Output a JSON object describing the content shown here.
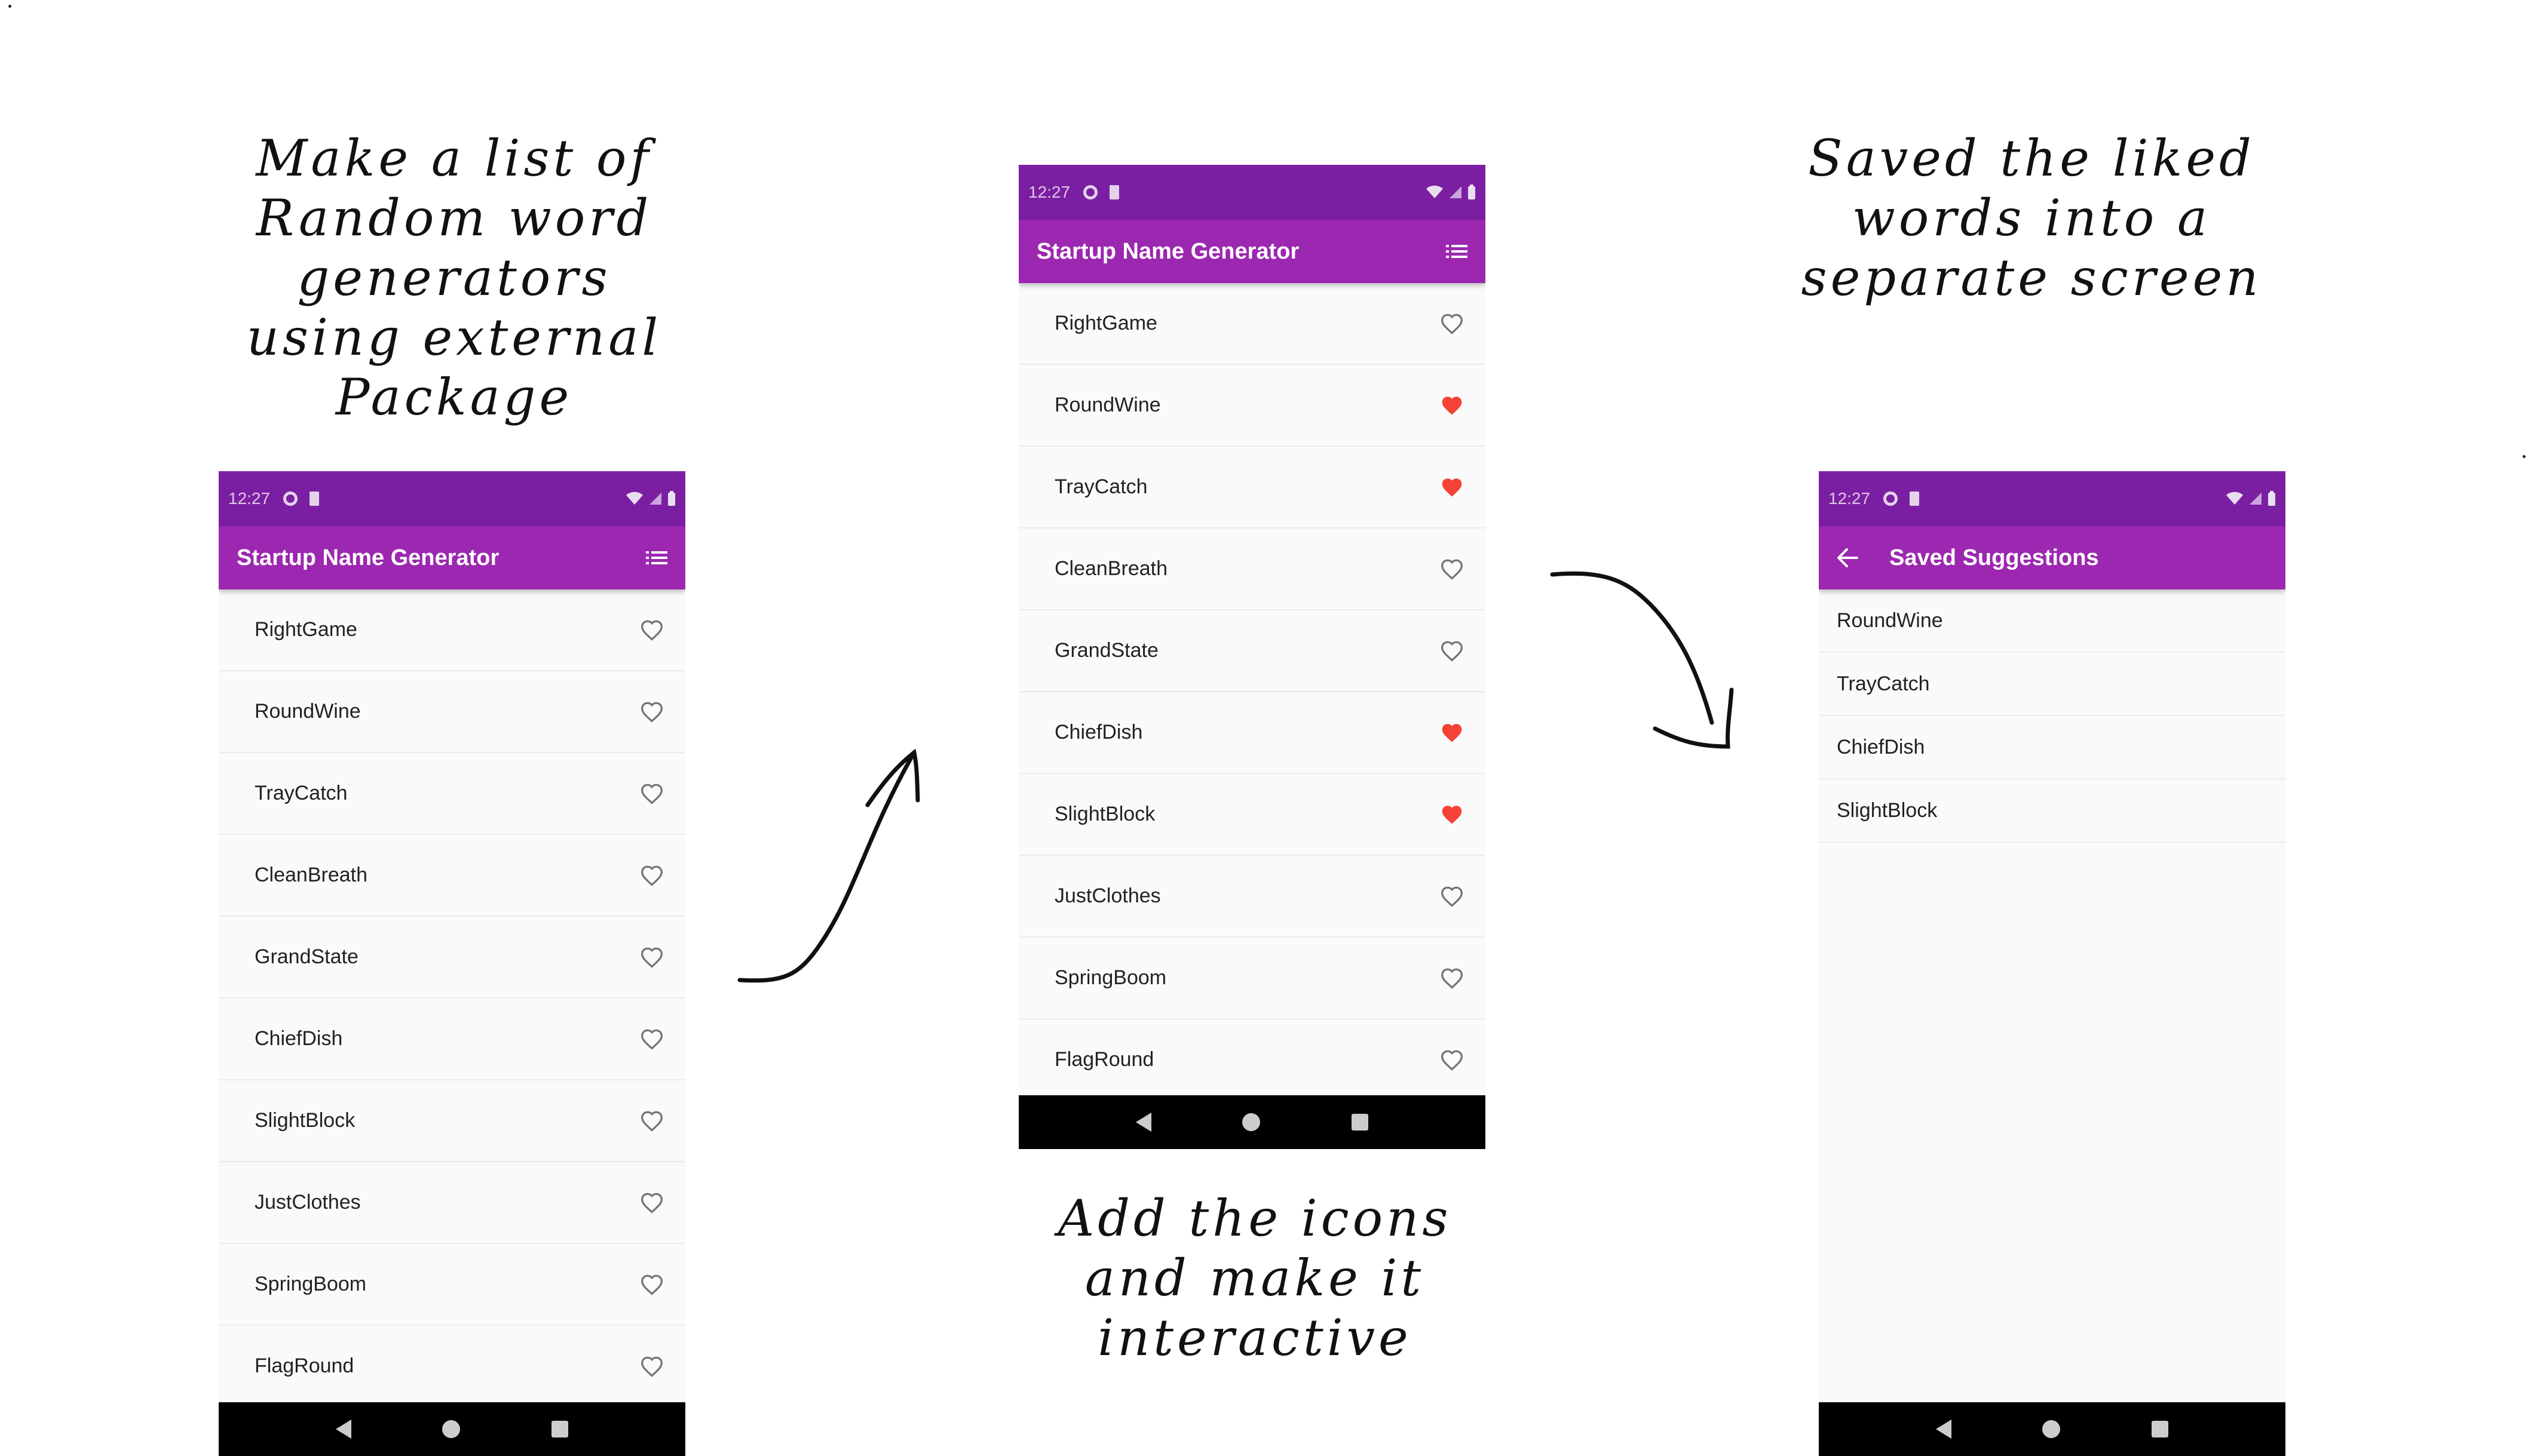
{
  "notes": {
    "list_note": "Make a list of\nRandom word\ngenerators\nusing external\nPackage",
    "saved_note": "Saved the liked\nwords into a\nseparate screen",
    "icons_note": "Add the icons\nand make it\ninteractive"
  },
  "colors": {
    "status_bar": "#7b1fa2",
    "app_bar": "#9c27b0",
    "heart_filled": "#f44336",
    "heart_outline": "#757575",
    "nav_bar": "#000000"
  },
  "status": {
    "time": "12:27"
  },
  "screen1": {
    "title": "Startup Name Generator",
    "icons": {
      "action": "list-icon"
    },
    "words": [
      {
        "label": "RightGame",
        "liked": false
      },
      {
        "label": "RoundWine",
        "liked": false
      },
      {
        "label": "TrayCatch",
        "liked": false
      },
      {
        "label": "CleanBreath",
        "liked": false
      },
      {
        "label": "GrandState",
        "liked": false
      },
      {
        "label": "ChiefDish",
        "liked": false
      },
      {
        "label": "SlightBlock",
        "liked": false
      },
      {
        "label": "JustClothes",
        "liked": false
      },
      {
        "label": "SpringBoom",
        "liked": false
      },
      {
        "label": "FlagRound",
        "liked": false
      }
    ]
  },
  "screen2": {
    "title": "Startup Name Generator",
    "icons": {
      "action": "list-icon"
    },
    "words": [
      {
        "label": "RightGame",
        "liked": false
      },
      {
        "label": "RoundWine",
        "liked": true
      },
      {
        "label": "TrayCatch",
        "liked": true
      },
      {
        "label": "CleanBreath",
        "liked": false
      },
      {
        "label": "GrandState",
        "liked": false
      },
      {
        "label": "ChiefDish",
        "liked": true
      },
      {
        "label": "SlightBlock",
        "liked": true
      },
      {
        "label": "JustClothes",
        "liked": false
      },
      {
        "label": "SpringBoom",
        "liked": false
      },
      {
        "label": "FlagRound",
        "liked": false
      }
    ]
  },
  "screen3": {
    "title": "Saved Suggestions",
    "icons": {
      "back": "arrow-back-icon"
    },
    "saved": [
      "RoundWine",
      "TrayCatch",
      "ChiefDish",
      "SlightBlock"
    ]
  }
}
